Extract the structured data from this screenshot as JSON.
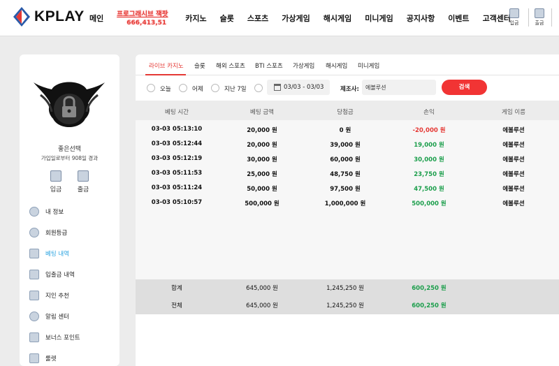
{
  "brand": {
    "name": "KPLAY",
    "accent": "#e53935",
    "blue": "#2a5aa8"
  },
  "nav": {
    "items": [
      "메인",
      "카지노",
      "슬롯",
      "스포츠",
      "가상게임",
      "해시게임",
      "미니게임",
      "공지사항",
      "이벤트",
      "고객센터"
    ],
    "promo_line1": "프로그래시브 잭팟",
    "promo_line2": "666,413,51",
    "deposit": "입금",
    "withdraw": "출금"
  },
  "sidebar": {
    "avatar_icon": "lock-wings-icon",
    "user_name": "좋은선택",
    "user_sub": "가입일로부터 908일 경과",
    "deposit": "입금",
    "withdraw": "출금",
    "menu": [
      {
        "label": "내 정보",
        "icon": "user-icon"
      },
      {
        "label": "회원등급",
        "icon": "badge-icon"
      },
      {
        "label": "베팅 내역",
        "icon": "edit-icon"
      },
      {
        "label": "입출금 내역",
        "icon": "wallet-icon"
      },
      {
        "label": "지인 추천",
        "icon": "referral-icon"
      },
      {
        "label": "알림 센터",
        "icon": "bell-icon"
      },
      {
        "label": "보너스 포인트",
        "icon": "gift-icon"
      },
      {
        "label": "룰렛",
        "icon": "roulette-icon"
      }
    ]
  },
  "tabs": [
    "라이브 카지노",
    "슬롯",
    "해외 스포츠",
    "BTI 스포츠",
    "가상게임",
    "해시게임",
    "미니게임"
  ],
  "filters": {
    "today": "오늘",
    "yesterday": "어제",
    "last7": "지난 7일",
    "date_range": "03/03 - 03/03",
    "maker_label": "제조사:",
    "maker_value": "에볼루션",
    "search": "검색"
  },
  "table": {
    "headers": [
      "베팅 시간",
      "베팅 금액",
      "당첨금",
      "손익",
      "게임 이름"
    ],
    "rows": [
      {
        "time": "03-03 05:13:10",
        "bet": "20,000 원",
        "win": "0 원",
        "profit": "-20,000 원",
        "game": "에볼루션",
        "sign": "neg"
      },
      {
        "time": "03-03 05:12:44",
        "bet": "20,000 원",
        "win": "39,000 원",
        "profit": "19,000 원",
        "game": "에볼루션",
        "sign": "pos"
      },
      {
        "time": "03-03 05:12:19",
        "bet": "30,000 원",
        "win": "60,000 원",
        "profit": "30,000 원",
        "game": "에볼루션",
        "sign": "pos"
      },
      {
        "time": "03-03 05:11:53",
        "bet": "25,000 원",
        "win": "48,750 원",
        "profit": "23,750 원",
        "game": "에볼루션",
        "sign": "pos"
      },
      {
        "time": "03-03 05:11:24",
        "bet": "50,000 원",
        "win": "97,500 원",
        "profit": "47,500 원",
        "game": "에볼루션",
        "sign": "pos"
      },
      {
        "time": "03-03 05:10:57",
        "bet": "500,000 원",
        "win": "1,000,000 원",
        "profit": "500,000 원",
        "game": "에볼루션",
        "sign": "pos"
      }
    ],
    "subtotal": {
      "label": "합계",
      "bet": "645,000 원",
      "win": "1,245,250 원",
      "profit": "600,250 원"
    },
    "total": {
      "label": "전체",
      "bet": "645,000 원",
      "win": "1,245,250 원",
      "profit": "600,250 원"
    }
  }
}
